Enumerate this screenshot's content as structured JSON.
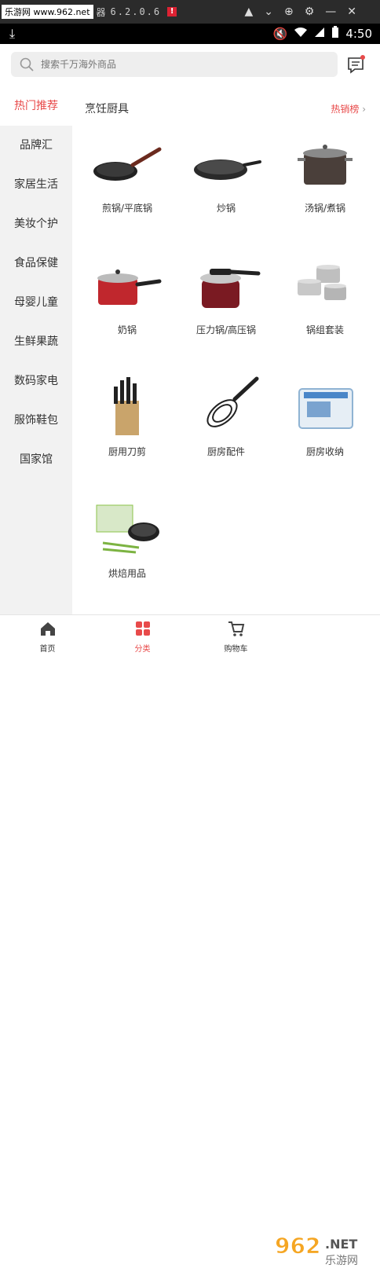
{
  "emulator": {
    "watermark_text": "乐游网 www.962.net",
    "title_suffix": "器",
    "version": "6.2.0.6",
    "alert": "!"
  },
  "status_bar": {
    "time": "4:50"
  },
  "search": {
    "placeholder": "搜索千万海外商品"
  },
  "sidebar": {
    "items": [
      {
        "label": "热门推荐",
        "active": true
      },
      {
        "label": "品牌汇"
      },
      {
        "label": "家居生活"
      },
      {
        "label": "美妆个护"
      },
      {
        "label": "食品保健"
      },
      {
        "label": "母婴儿童"
      },
      {
        "label": "生鲜果蔬"
      },
      {
        "label": "数码家电"
      },
      {
        "label": "服饰鞋包"
      },
      {
        "label": "国家馆"
      }
    ]
  },
  "section": {
    "title": "烹饪厨具",
    "hot_link": "热销榜"
  },
  "products": [
    {
      "label": "煎锅/平底锅",
      "icon": "frying-pan"
    },
    {
      "label": "炒锅",
      "icon": "wok"
    },
    {
      "label": "汤锅/煮锅",
      "icon": "stock-pot"
    },
    {
      "label": "奶锅",
      "icon": "milk-pot"
    },
    {
      "label": "压力锅/高压锅",
      "icon": "pressure-cooker"
    },
    {
      "label": "锅组套装",
      "icon": "cookware-set"
    },
    {
      "label": "厨用刀剪",
      "icon": "knife-block"
    },
    {
      "label": "厨房配件",
      "icon": "whisk"
    },
    {
      "label": "厨房收纳",
      "icon": "storage-box"
    },
    {
      "label": "烘焙用品",
      "icon": "baking-set"
    }
  ],
  "tabbar": {
    "tabs": [
      {
        "label": "首页",
        "icon": "home-icon"
      },
      {
        "label": "分类",
        "icon": "category-icon",
        "active": true
      },
      {
        "label": "购物车",
        "icon": "cart-icon"
      }
    ],
    "watermark": "962.NET 乐游网"
  },
  "colors": {
    "accent": "#e84a4a",
    "sidebar_bg": "#f2f2f2",
    "search_bg": "#eeeeee"
  }
}
